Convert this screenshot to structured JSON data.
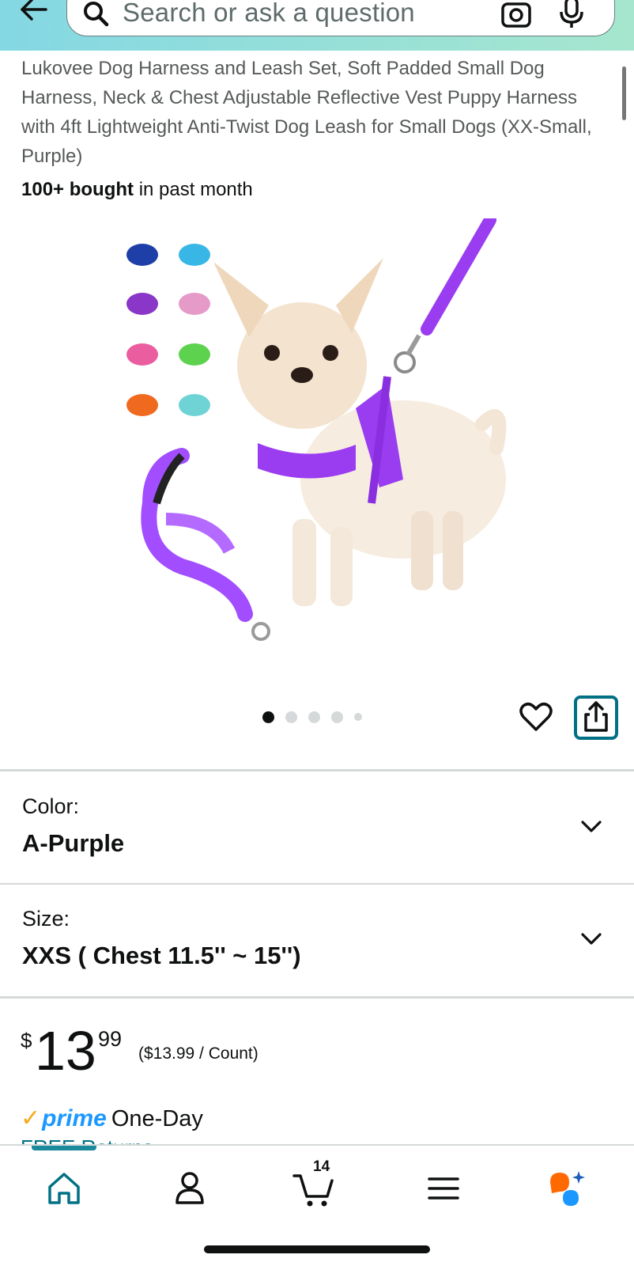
{
  "header": {
    "search_placeholder": "Search or ask a question"
  },
  "product": {
    "title": "Lukovee Dog Harness and Leash Set, Soft Padded Small Dog Harness, Neck & Chest Adjustable Reflective Vest Puppy Harness with 4ft Lightweight Anti-Twist Dog Leash for Small Dogs (XX-Small, Purple)",
    "bought_bold": "100+ bought",
    "bought_rest": " in past month",
    "image_count": 5,
    "active_image": 1
  },
  "variations": {
    "color_label": "Color:",
    "color_value": "A-Purple",
    "size_label": "Size:",
    "size_value": "XXS ( Chest 11.5'' ~ 15'')"
  },
  "price": {
    "currency": "$",
    "whole": "13",
    "fraction": "99",
    "unit": "($13.99 / Count)"
  },
  "delivery": {
    "prime_check": "✓",
    "prime_word": "prime",
    "speed": "One-Day",
    "returns": "FREE Returns"
  },
  "bottom_nav": {
    "cart_count": "14",
    "active": "home"
  },
  "colors": {
    "accent": "#007185",
    "prime_blue": "#1a98ff",
    "prime_check": "#f7a81b",
    "harness_purple": "#9a3cf0"
  }
}
